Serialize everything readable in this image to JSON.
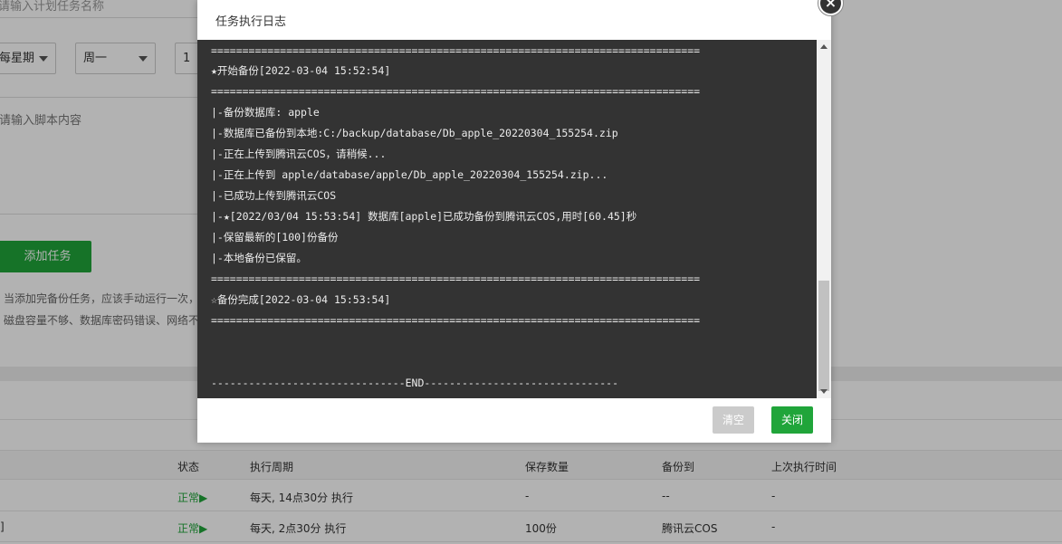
{
  "background": {
    "task_name_placeholder": "请输入计划任务名称",
    "cycle_select": "每星期",
    "weekday_select": "周一",
    "hour_input": "1",
    "script_placeholder": "请输入脚本内容",
    "add_task_button": "添加任务",
    "note_line1": "当添加完备份任务，应该手动运行一次，",
    "note_line2": "磁盘容量不够、数据库密码错误、网络不",
    "table": {
      "headers": [
        "状态",
        "执行周期",
        "保存数量",
        "备份到",
        "上次执行时间"
      ],
      "rows": [
        {
          "prefix": "",
          "status": "正常▶",
          "cycle": "每天, 14点30分 执行",
          "count": "-",
          "backup_to": "--",
          "last_run": "-"
        },
        {
          "prefix": "]",
          "status": "正常▶",
          "cycle": "每天, 2点30分 执行",
          "count": "100份",
          "backup_to": "腾讯云COS",
          "last_run": "-"
        }
      ]
    }
  },
  "modal": {
    "title": "任务执行日志",
    "close_glyph": "×",
    "log_lines": [
      "==============================================================================",
      "★开始备份[2022-03-04 15:52:54]",
      "==============================================================================",
      "|-备份数据库: apple",
      "|-数据库已备份到本地:C:/backup/database/Db_apple_20220304_155254.zip",
      "|-正在上传到腾讯云COS，请稍候...",
      "|-正在上传到 apple/database/apple/Db_apple_20220304_155254.zip...",
      "|-已成功上传到腾讯云COS",
      "|-★[2022/03/04 15:53:54] 数据库[apple]已成功备份到腾讯云COS,用时[60.45]秒",
      "|-保留最新的[100]份备份",
      "|-本地备份已保留。",
      "==============================================================================",
      "☆备份完成[2022-03-04 15:53:54]",
      "==============================================================================",
      "",
      "",
      "",
      "-------------------------------END-------------------------------"
    ],
    "clear_button": "清空",
    "close_button": "关闭"
  },
  "colors": {
    "accent": "#20a53a",
    "log_bg": "#333333",
    "log_text": "#ececec"
  }
}
